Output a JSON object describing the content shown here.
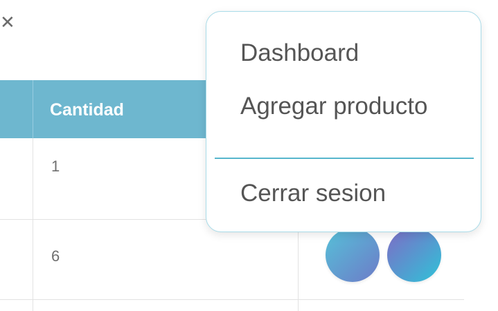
{
  "top_bar": {
    "corner_icon": "close-icon-partial",
    "corner_glyph": "✕"
  },
  "table": {
    "columns": [
      "Cantidad"
    ],
    "rows": [
      {
        "cantidad": "1"
      },
      {
        "cantidad": "6"
      },
      {
        "cantidad": ""
      }
    ],
    "header_color": "#6eb7cf"
  },
  "actions": {
    "edit_icon": "pencil-icon",
    "delete_icon": "trash-icon"
  },
  "dropdown": {
    "items": [
      "Dashboard",
      "Agregar producto"
    ],
    "footer_item": "Cerrar sesion",
    "accent": "#56b6cc"
  }
}
